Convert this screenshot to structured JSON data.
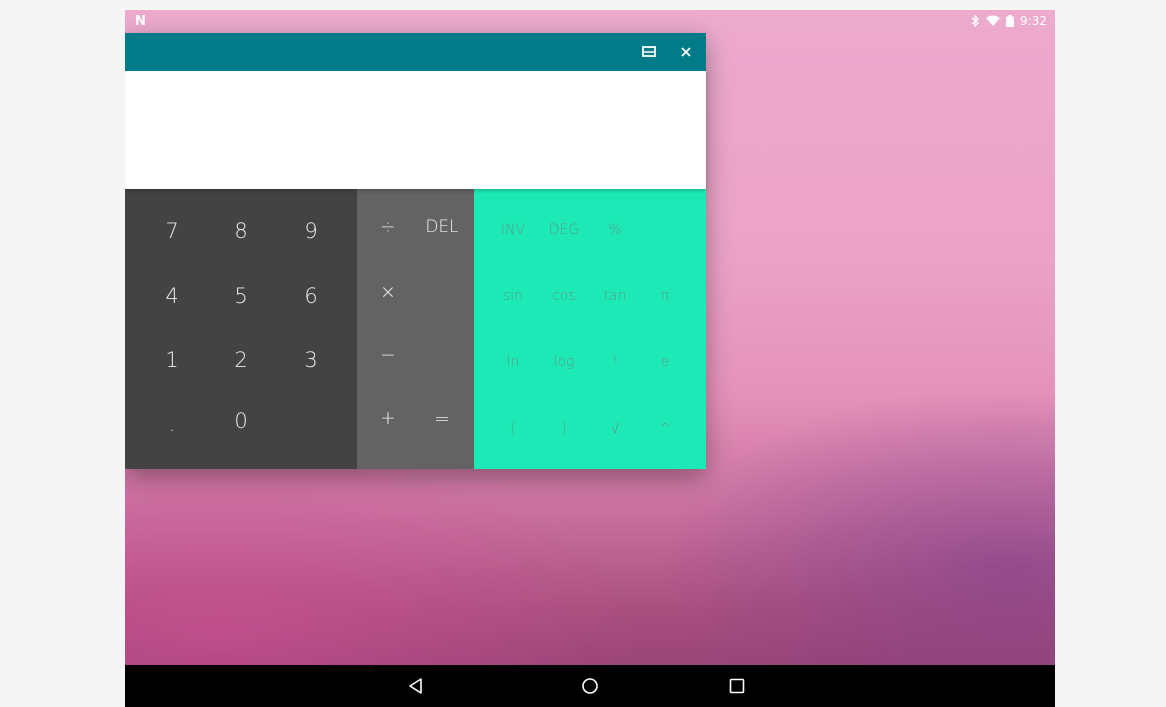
{
  "status_bar": {
    "notification_icon": "N",
    "time": "9:32",
    "icons": [
      "bluetooth-icon",
      "wifi-icon",
      "battery-icon"
    ]
  },
  "window": {
    "title_bar_color": "#007b87",
    "buttons": [
      "maximize-icon",
      "close-icon"
    ],
    "display_value": ""
  },
  "keypad": {
    "numbers": [
      "7",
      "8",
      "9",
      "4",
      "5",
      "6",
      "1",
      "2",
      "3",
      ".",
      "0"
    ],
    "operators": [
      "÷",
      "DEL",
      "×",
      "−",
      "+",
      "="
    ],
    "advanced": [
      "INV",
      "DEG",
      "%",
      "sin",
      "cos",
      "tan",
      "π",
      "ln",
      "log",
      "!",
      "e",
      "(",
      ")",
      "√",
      "^"
    ]
  },
  "colors": {
    "numpad": "#434343",
    "oppad": "#636363",
    "advanced": "#1de9b6"
  },
  "nav_bar": {
    "buttons": [
      "back-icon",
      "home-icon",
      "recents-icon"
    ]
  }
}
